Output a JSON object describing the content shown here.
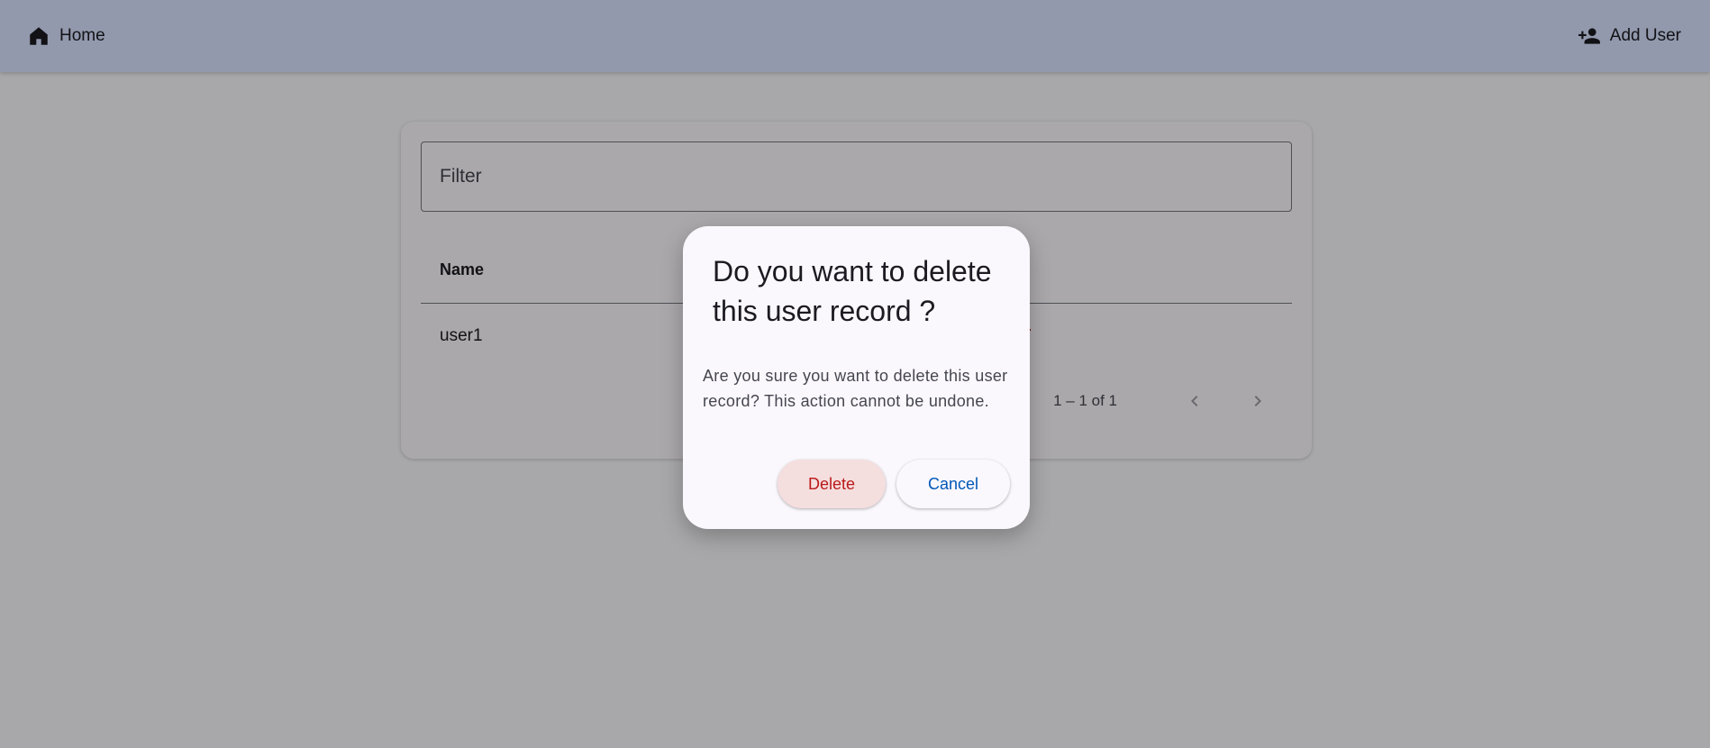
{
  "toolbar": {
    "home_icon": "home-icon",
    "home_label": "Home",
    "add_user_icon": "person-add-icon",
    "add_user_label": "Add User"
  },
  "filter": {
    "placeholder": "Filter"
  },
  "table": {
    "columns": [
      "Name"
    ],
    "rows": [
      {
        "name": "user1",
        "action_icon": "trash-icon"
      }
    ]
  },
  "paginator": {
    "range_label": "1 – 1 of 1",
    "prev_icon": "chevron-left-icon",
    "next_icon": "chevron-right-icon"
  },
  "dialog": {
    "title": "Do you want to delete this user record ?",
    "message": "Are you sure you want to delete this user record? This action cannot be undone.",
    "delete_label": "Delete",
    "cancel_label": "Cancel"
  },
  "colors": {
    "toolbar_bg": "#d8e2ff",
    "danger": "#ba1a1a",
    "delete_button_bg": "#f5dede",
    "primary": "#0057b7",
    "surface": "#fbf8fd"
  }
}
